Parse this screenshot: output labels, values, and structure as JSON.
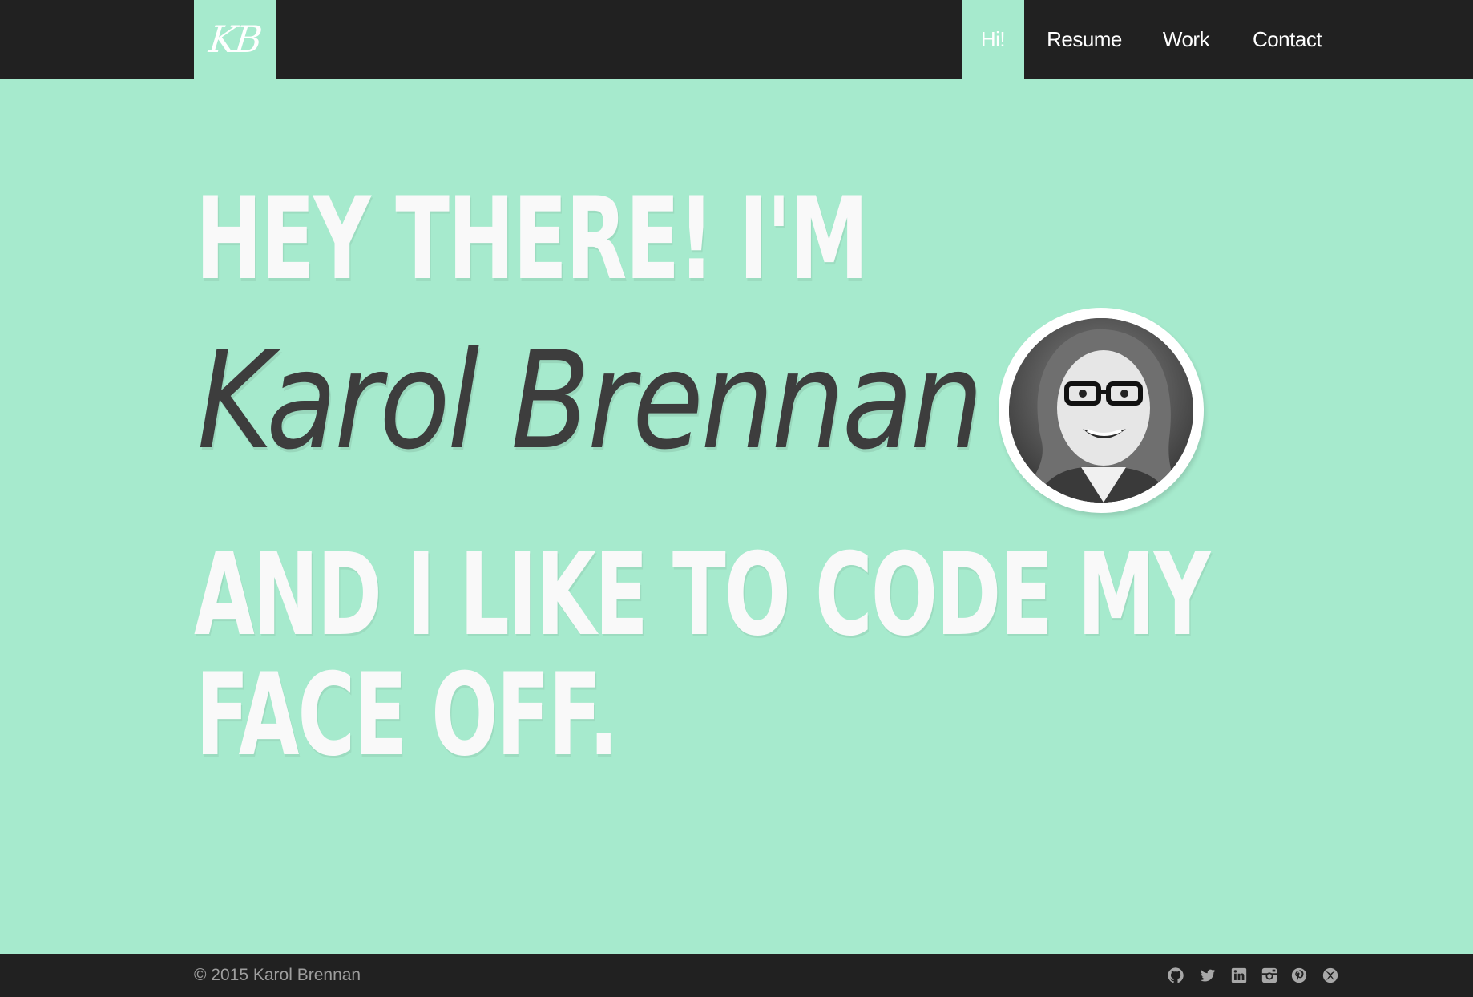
{
  "header": {
    "logo_text": "KB",
    "nav": [
      {
        "label": "Hi!",
        "active": true
      },
      {
        "label": "Resume",
        "active": false
      },
      {
        "label": "Work",
        "active": false
      },
      {
        "label": "Contact",
        "active": false
      }
    ]
  },
  "hero": {
    "line1": "HEY THERE! I'M",
    "name": "Karol Brennan",
    "line3": "AND I LIKE TO CODE MY",
    "line4": "FACE OFF.",
    "avatar_icon": "profile-photo"
  },
  "footer": {
    "copyright": "© 2015 Karol Brennan",
    "social_icons": [
      "github-icon",
      "twitter-icon",
      "linkedin-icon",
      "instagram-icon",
      "pinterest-icon",
      "xbox-icon"
    ]
  },
  "colors": {
    "accent": "#a6eacd",
    "bar": "#212121",
    "hero_text": "#f9f9f9",
    "name_text": "#3d3d3d"
  }
}
